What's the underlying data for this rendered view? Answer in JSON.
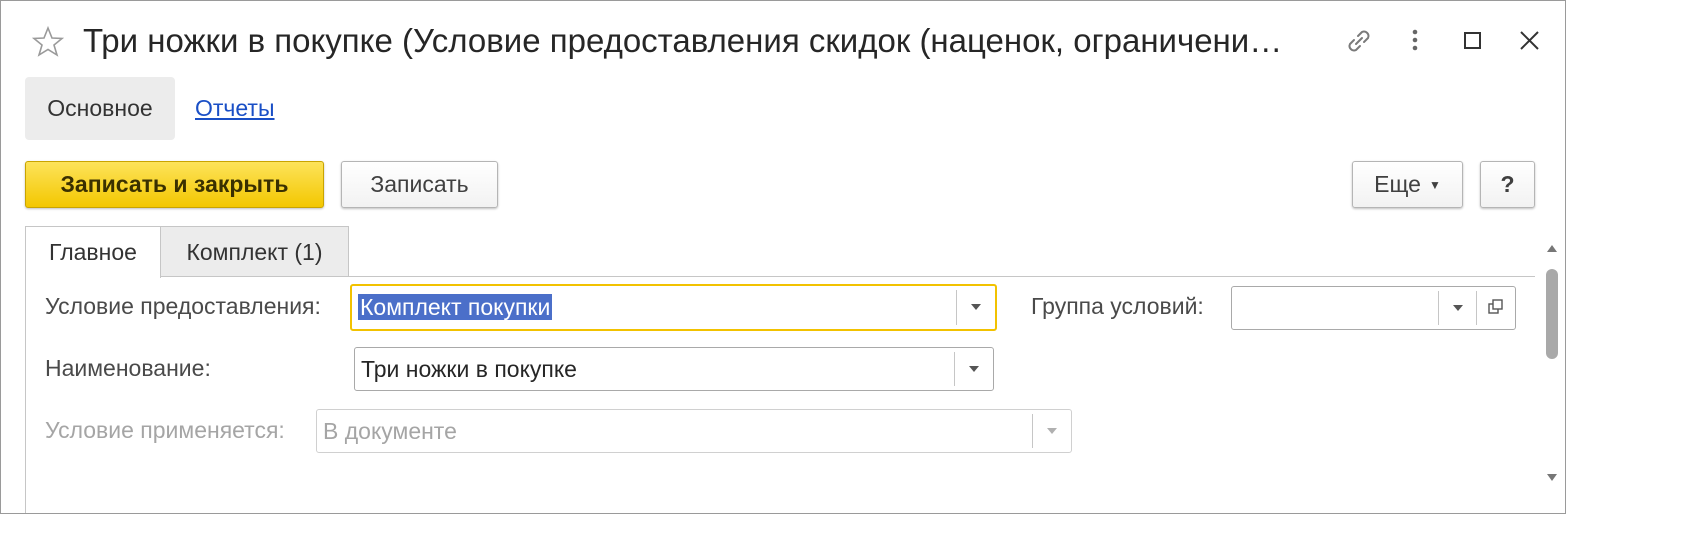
{
  "window": {
    "title": "Три ножки в покупке (Условие предоставления скидок (наценок, ограничени…"
  },
  "nav": {
    "main_label": "Основное",
    "reports_label": "Отчеты"
  },
  "toolbar": {
    "save_close_label": "Записать и закрыть",
    "save_label": "Записать",
    "more_label": "Еще",
    "help_label": "?"
  },
  "tabs": [
    {
      "label": "Главное",
      "active": true
    },
    {
      "label": "Комплект (1)",
      "active": false
    }
  ],
  "form": {
    "condition": {
      "label": "Условие предоставления:",
      "value": "Комплект покупки"
    },
    "group": {
      "label": "Группа условий:",
      "value": ""
    },
    "name": {
      "label": "Наименование:",
      "value": "Три ножки в покупке"
    },
    "applies": {
      "label": "Условие применяется:",
      "value": "В документе"
    }
  },
  "colors": {
    "primary_button": "#f3c700",
    "link": "#1a4fc6",
    "selection": "#4b6fc9",
    "focus_border": "#f2c200"
  },
  "icons": [
    "star-icon",
    "link-icon",
    "more-vertical-icon",
    "maximize-icon",
    "close-icon",
    "dropdown-arrow-icon",
    "open-form-icon"
  ]
}
